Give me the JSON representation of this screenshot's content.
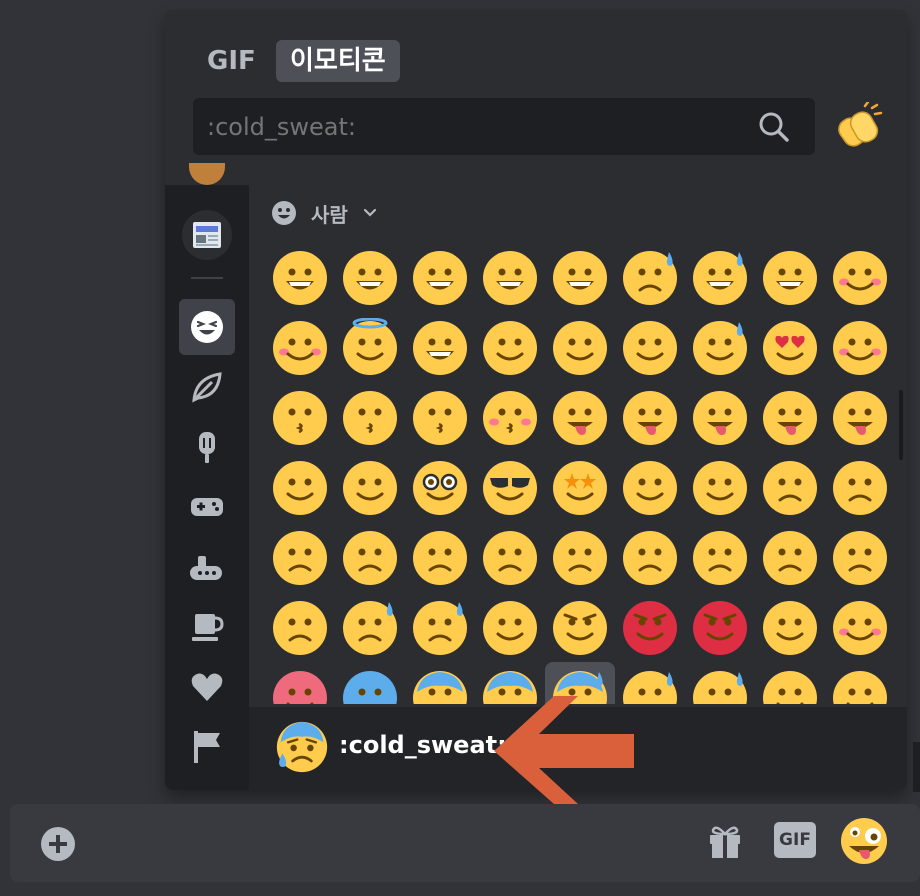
{
  "picker": {
    "tabs": [
      {
        "label": "GIF",
        "active": false
      },
      {
        "label": "이모티콘",
        "active": true
      }
    ],
    "search": {
      "value": "",
      "placeholder": ":cold_sweat:"
    },
    "skin_tone_icon": "clapping-hands-icon",
    "category": {
      "label": "사람",
      "icon": "grinning-face-icon",
      "chevron": "chevron-down-icon"
    },
    "sidebar": [
      {
        "name": "server-avatar",
        "icon": "server-avatar-icon"
      },
      {
        "name": "newspaper",
        "icon": "newspaper-icon"
      },
      {
        "name": "people",
        "icon": "smiley-icon",
        "active": true
      },
      {
        "name": "nature",
        "icon": "leaf-icon"
      },
      {
        "name": "food",
        "icon": "popsicle-icon"
      },
      {
        "name": "activities",
        "icon": "gamepad-icon"
      },
      {
        "name": "travel",
        "icon": "submarine-icon"
      },
      {
        "name": "objects",
        "icon": "coffee-icon"
      },
      {
        "name": "symbols",
        "icon": "heart-icon"
      },
      {
        "name": "flags",
        "icon": "flag-icon"
      }
    ],
    "emoji_rows": [
      [
        "grinning",
        "smiley",
        "smile",
        "grin",
        "laughing",
        "sweat-smile",
        "joy",
        "rofl",
        "relaxed"
      ],
      [
        "blush",
        "innocent",
        "slight-smile",
        "upside-down",
        "wink",
        "relieved",
        "face-holding-tears",
        "heart-eyes",
        "smiling-hearts"
      ],
      [
        "kissing-heart",
        "kissing",
        "kissing-smiling-eyes",
        "kissing-closed-eyes",
        "yum",
        "tongue",
        "squinting-tongue",
        "winking-tongue",
        "zany"
      ],
      [
        "raised-eyebrow",
        "monocle",
        "nerd",
        "sunglasses",
        "star-struck",
        "partying",
        "smirk",
        "unamused",
        "disappointed"
      ],
      [
        "pensive",
        "worried",
        "confused",
        "slight-frown",
        "frowning",
        "persevere",
        "confounded",
        "tired",
        "weary"
      ],
      [
        "pleading",
        "cry",
        "sob",
        "triumph",
        "angry",
        "rage",
        "cursing",
        "exploding-head",
        "flushed"
      ],
      [
        "hot",
        "cold",
        "scream",
        "fearful",
        "cold-sweat",
        "disappointed-relieved",
        "sweat",
        "hugging",
        "thinking"
      ]
    ],
    "hovered_emoji": "cold-sweat",
    "preview": {
      "name": ":cold_sweat:",
      "icon": "cold-sweat-icon"
    }
  },
  "chat_bar": {
    "add_icon": "plus-circle-icon",
    "gift_icon": "gift-icon",
    "gif_label": "GIF",
    "emoji_icon": "zany-face-icon"
  },
  "colors": {
    "background": "#313338",
    "picker_bg": "#2b2d31",
    "rail_bg": "#1e1f22",
    "emoji_yellow": "#ffcc4d",
    "arrow": "#d9603b",
    "text": "#b5bac1"
  }
}
